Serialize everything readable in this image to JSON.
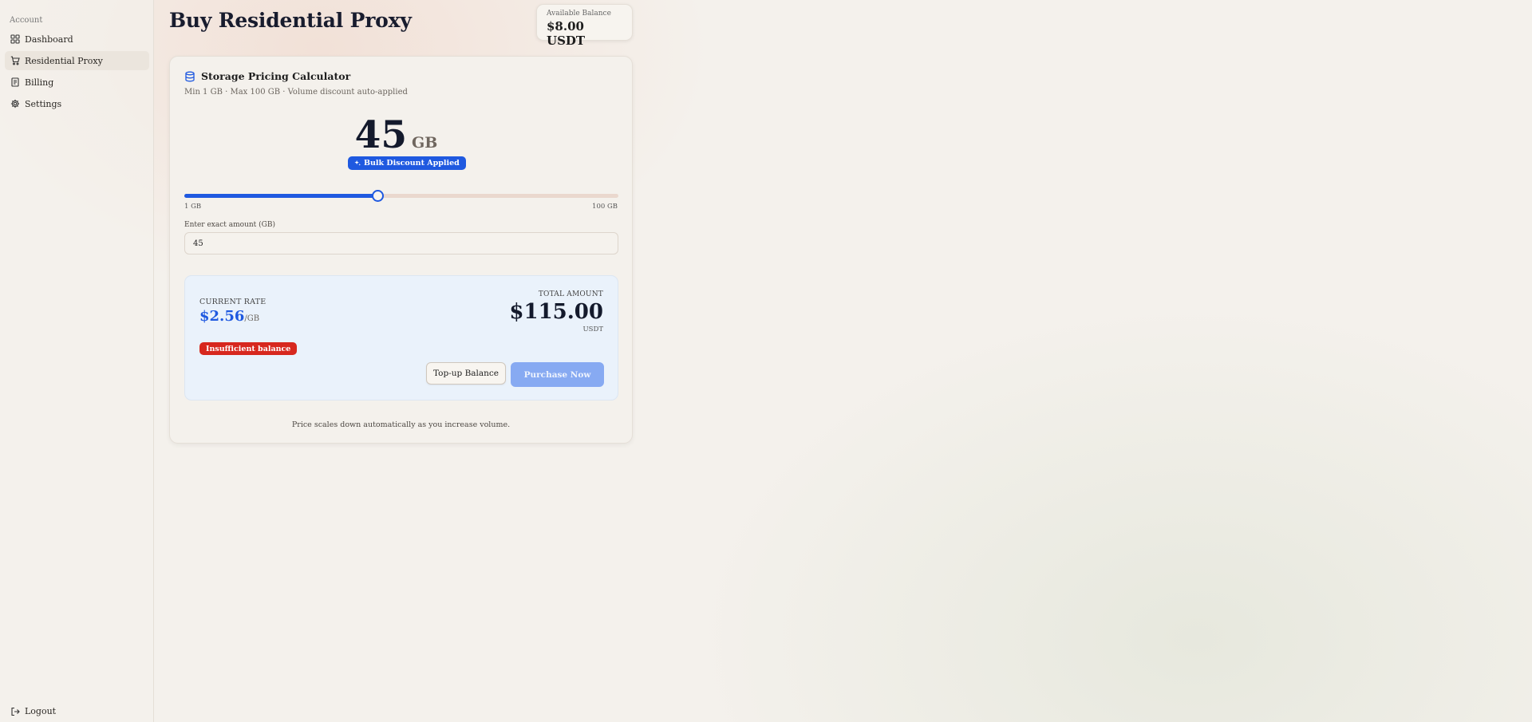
{
  "sidebar": {
    "section_label": "Account",
    "items": [
      {
        "label": "Dashboard",
        "icon": "grid-icon",
        "active": false
      },
      {
        "label": "Residential Proxy",
        "icon": "cart-icon",
        "active": true
      },
      {
        "label": "Billing",
        "icon": "receipt-icon",
        "active": false
      },
      {
        "label": "Settings",
        "icon": "gear-icon",
        "active": false
      }
    ],
    "logout_label": "Logout"
  },
  "header": {
    "title": "Buy Residential Proxy",
    "balance_label": "Available Balance",
    "balance_value": "$8.00 USDT"
  },
  "calculator": {
    "title": "Storage Pricing Calculator",
    "subtitle": "Min 1 GB · Max 100 GB · Volume discount auto-applied",
    "amount": "45",
    "unit": "GB",
    "discount_badge": "Bulk Discount Applied",
    "slider": {
      "min": 1,
      "max": 100,
      "value": 45,
      "min_label": "1 GB",
      "max_label": "100 GB"
    },
    "input_label": "Enter exact amount (GB)",
    "input_value": "45"
  },
  "summary": {
    "rate_label": "CURRENT RATE",
    "rate_value": "$2.56",
    "rate_unit": "/GB",
    "total_label": "TOTAL AMOUNT",
    "total_value": "$115.00",
    "total_unit": "USDT",
    "error_badge": "Insufficient balance",
    "topup_label": "Top-up Balance",
    "purchase_label": "Purchase Now"
  },
  "footnote": "Price scales down automatically as you increase volume.",
  "colors": {
    "accent": "#1f59e0",
    "error": "#d7281e",
    "purchase_disabled": "#87aaf2",
    "background": "#f4f1ec"
  }
}
